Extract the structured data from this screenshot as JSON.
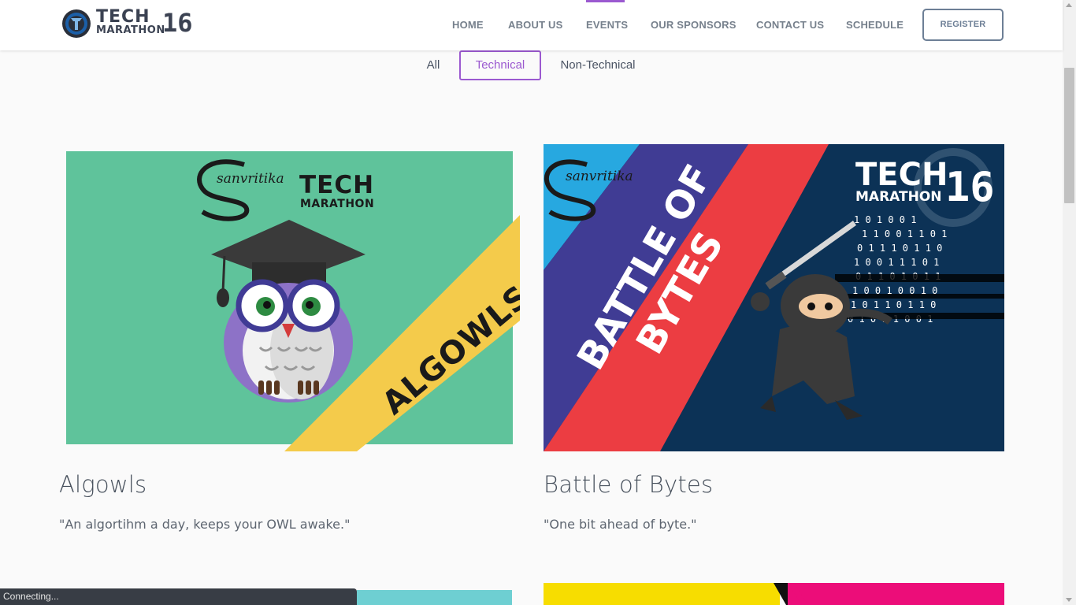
{
  "logo": {
    "line1": "TECH",
    "line2": "MARATHON",
    "number": "16"
  },
  "nav": {
    "items": [
      {
        "label": "HOME"
      },
      {
        "label": "ABOUT US"
      },
      {
        "label": "EVENTS"
      },
      {
        "label": "OUR SPONSORS"
      },
      {
        "label": "CONTACT US"
      },
      {
        "label": "SCHEDULE"
      }
    ],
    "active": "EVENTS",
    "register_label": "REGISTER"
  },
  "filters": {
    "items": [
      {
        "label": "All"
      },
      {
        "label": "Technical"
      },
      {
        "label": "Non-Technical"
      }
    ],
    "active": "Technical"
  },
  "events": [
    {
      "title": "Algowls",
      "quote": "\"An algortihm a day, keeps your OWL awake.\"",
      "image": {
        "brand": "sanvritika",
        "tech": "TECH",
        "marathon": "MARATHON",
        "banner": "ALGOWLS",
        "background": "#5fc39b",
        "stripe": "#f4cb4b"
      }
    },
    {
      "title": "Battle of Bytes",
      "quote": "\"One bit ahead of byte.\"",
      "image": {
        "brand": "sanvritika",
        "tech": "TECH",
        "marathon": "MARATHON",
        "number": "16",
        "line1": "BATTLE OF",
        "line2": "BYTES",
        "background": "#0c3256",
        "stripe1": "#403c94",
        "stripe2": "#ec3d42"
      }
    }
  ],
  "status": {
    "text": "Connecting..."
  },
  "colors": {
    "accent": "#9b59d0",
    "nav_text": "#76808c"
  }
}
